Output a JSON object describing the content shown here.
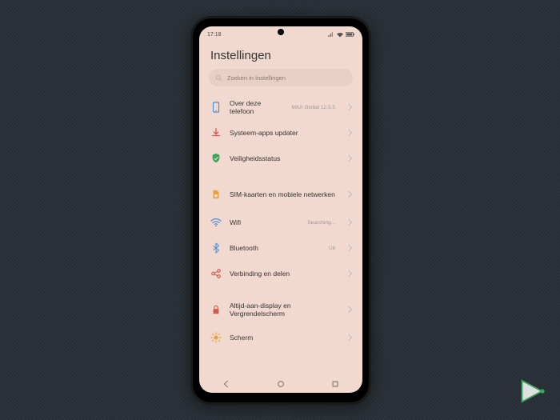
{
  "status": {
    "time": "17:18"
  },
  "title": "Instellingen",
  "search": {
    "placeholder": "Zoeken in Instellingen"
  },
  "rows": {
    "about": {
      "label": "Over deze telefoon",
      "sub": "MIUI Global 12.5.5"
    },
    "updater": {
      "label": "Systeem-apps updater"
    },
    "security": {
      "label": "Veiligheidsstatus"
    },
    "sim": {
      "label": "SIM-kaarten en mobiele netwerken"
    },
    "wifi": {
      "label": "Wifi",
      "sub": "Searching..."
    },
    "bt": {
      "label": "Bluetooth",
      "sub": "Uit"
    },
    "sharing": {
      "label": "Verbinding en delen"
    },
    "aod": {
      "label": "Altijd-aan-display en Vergrendelscherm"
    },
    "display": {
      "label": "Scherm"
    }
  }
}
